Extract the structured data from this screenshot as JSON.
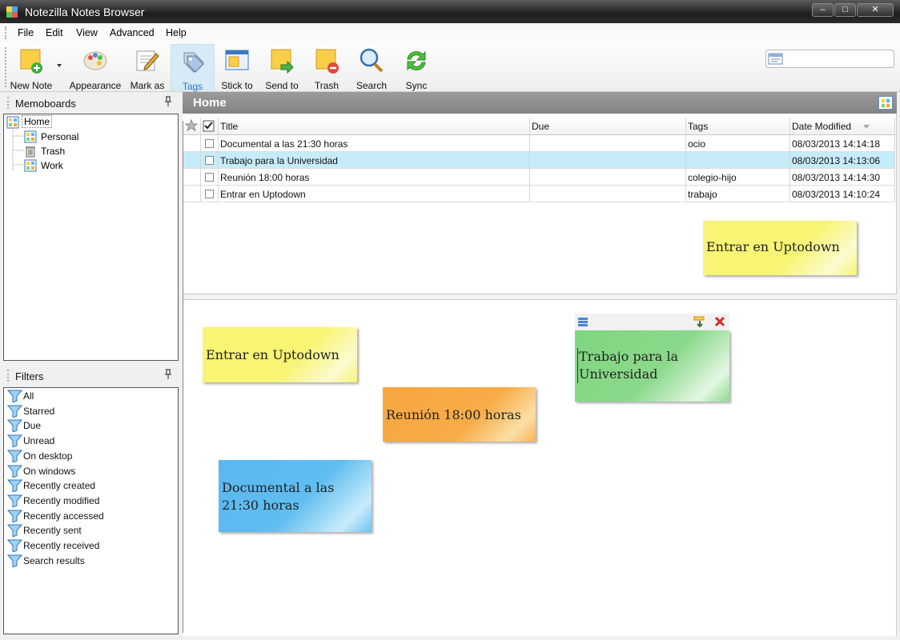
{
  "window": {
    "title": "Notezilla Notes Browser"
  },
  "menu": [
    "File",
    "Edit",
    "View",
    "Advanced",
    "Help"
  ],
  "toolbar": {
    "buttons": [
      {
        "label": "New Note",
        "icon": "new-note-icon"
      },
      {
        "label": "Appearance",
        "icon": "appearance-icon"
      },
      {
        "label": "Mark as",
        "icon": "mark-as-icon"
      },
      {
        "label": "Tags",
        "icon": "tags-icon",
        "active": true
      },
      {
        "label": "Stick to",
        "icon": "stick-to-icon"
      },
      {
        "label": "Send to",
        "icon": "send-to-icon"
      },
      {
        "label": "Trash",
        "icon": "trash-icon"
      },
      {
        "label": "Search",
        "icon": "search-icon"
      },
      {
        "label": "Sync",
        "icon": "sync-icon"
      }
    ],
    "search": {
      "value": "",
      "placeholder": ""
    }
  },
  "memoboards": {
    "title": "Memoboards",
    "items": [
      {
        "label": "Home",
        "selected": true
      },
      {
        "label": "Personal"
      },
      {
        "label": "Trash"
      },
      {
        "label": "Work"
      }
    ]
  },
  "filters": {
    "title": "Filters",
    "items": [
      "All",
      "Starred",
      "Due",
      "Unread",
      "On desktop",
      "On windows",
      "Recently created",
      "Recently modified",
      "Recently accessed",
      "Recently sent",
      "Recently received",
      "Search results"
    ]
  },
  "main": {
    "title": "Home",
    "columns": [
      "Title",
      "Due",
      "Tags",
      "Date Modified"
    ],
    "rows": [
      {
        "title": "Documental a las 21:30 horas",
        "due": "",
        "tags": "ocio",
        "modified": "08/03/2013 14:14:18"
      },
      {
        "title": "Trabajo para la Universidad",
        "due": "",
        "tags": "",
        "modified": "08/03/2013 14:13:06",
        "selected": true
      },
      {
        "title": "Reunión 18:00 horas",
        "due": "",
        "tags": "colegio-hijo",
        "modified": "08/03/2013 14:14:30"
      },
      {
        "title": "Entrar en Uptodown",
        "due": "",
        "tags": "trabajo",
        "modified": "08/03/2013 14:10:24"
      }
    ]
  },
  "notes": [
    {
      "text": "Entrar en Uptodown",
      "color": "#f8f474"
    },
    {
      "text": "Entrar en Uptodown",
      "color": "#f8f474"
    },
    {
      "text": "Reunión 18:00 horas",
      "color": "#f7a640"
    },
    {
      "text": "Documental a las 21:30 horas",
      "color": "#5ab8ef"
    },
    {
      "text": "Trabajo para la Universidad",
      "color": "#7fd57f"
    }
  ],
  "colors": {
    "selection": "#c6ecfa",
    "header_bar": "#8f8f8f",
    "tags_active": "#2a77c9"
  }
}
